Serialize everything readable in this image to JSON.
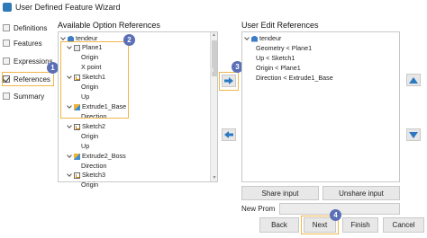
{
  "window": {
    "title": "User Defined Feature Wizard"
  },
  "sidebar": {
    "items": [
      {
        "label": "Definitions",
        "checked": false
      },
      {
        "label": "Features",
        "checked": false
      },
      {
        "label": "Expressions",
        "checked": false
      },
      {
        "label": "References",
        "checked": true
      },
      {
        "label": "Summary",
        "checked": false
      }
    ]
  },
  "available": {
    "heading": "Available Option References",
    "tree": [
      {
        "label": "tendeur",
        "icon": "part-icon"
      },
      {
        "label": "Plane1",
        "icon": "plane-icon"
      },
      {
        "label": "Origin"
      },
      {
        "label": "X point"
      },
      {
        "label": "Sketch1",
        "icon": "sketch-icon"
      },
      {
        "label": "Origin"
      },
      {
        "label": "Up"
      },
      {
        "label": "Extrude1_Base",
        "icon": "extrude-icon"
      },
      {
        "label": "Direction"
      },
      {
        "label": "Sketch2",
        "icon": "sketch-icon"
      },
      {
        "label": "Origin"
      },
      {
        "label": "Up"
      },
      {
        "label": "Extrude2_Boss",
        "icon": "extrude-icon"
      },
      {
        "label": "Direction"
      },
      {
        "label": "Sketch3",
        "icon": "sketch-icon"
      },
      {
        "label": "Origin"
      }
    ]
  },
  "user_edit": {
    "heading": "User Edit References",
    "tree": [
      {
        "label": "tendeur",
        "icon": "part-icon"
      },
      {
        "label": "Geometry < Plane1"
      },
      {
        "label": "Up < Sketch1"
      },
      {
        "label": "Origin < Plane1"
      },
      {
        "label": "Direction < Extrude1_Base"
      }
    ]
  },
  "buttons": {
    "share": "Share input",
    "unshare": "Unshare input",
    "back": "Back",
    "next": "Next",
    "finish": "Finish",
    "cancel": "Cancel"
  },
  "new_prompt": {
    "label": "New Prom",
    "value": ""
  },
  "callouts": [
    "1",
    "2",
    "3",
    "4"
  ],
  "colors": {
    "callout": "#5a6fb6",
    "highlight": "#f0b64a",
    "move_arrow": "#2b79c2"
  }
}
